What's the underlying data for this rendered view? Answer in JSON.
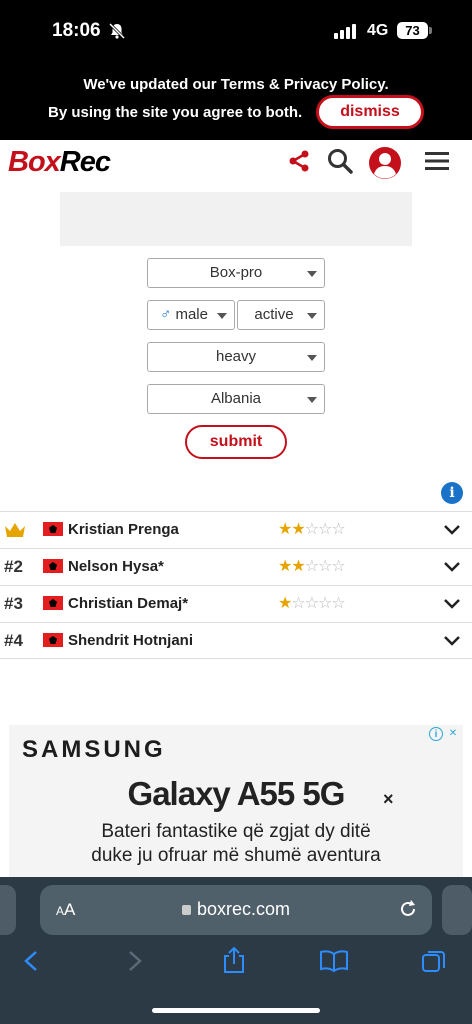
{
  "status": {
    "time": "18:06",
    "network": "4G",
    "battery": "73"
  },
  "notice": {
    "line1": "We've updated our Terms & Privacy Policy.",
    "line2": "By using the site you agree to both.",
    "dismiss": "dismiss"
  },
  "header": {
    "logo_box": "Box",
    "logo_rec": "Rec"
  },
  "filters": {
    "ratings": "Box-pro",
    "sex": "male",
    "sex_symbol": "♂",
    "status": "active",
    "division": "heavy",
    "country": "Albania",
    "submit": "submit"
  },
  "info_icon": "i",
  "boxers": [
    {
      "rank": "",
      "crown": true,
      "name": "Kristian Prenga",
      "stars": 2
    },
    {
      "rank": "#2",
      "crown": false,
      "name": "Nelson Hysa*",
      "stars": 2
    },
    {
      "rank": "#3",
      "crown": false,
      "name": "Christian Demaj*",
      "stars": 1
    },
    {
      "rank": "#4",
      "crown": false,
      "name": "Shendrit Hotnjani",
      "stars": 0
    }
  ],
  "ad": {
    "brand": "SAMSUNG",
    "title": "Galaxy A55 5G",
    "desc1": "Bateri fantastike që zgjat dy ditë",
    "desc2": "duke ju ofruar më shumë aventura",
    "close": "×"
  },
  "browser": {
    "aa_small": "A",
    "aa_big": "A",
    "url": "boxrec.com"
  },
  "colors": {
    "brand_red": "#c4101b",
    "star": "#e6a400",
    "info_blue": "#1a73c8"
  }
}
